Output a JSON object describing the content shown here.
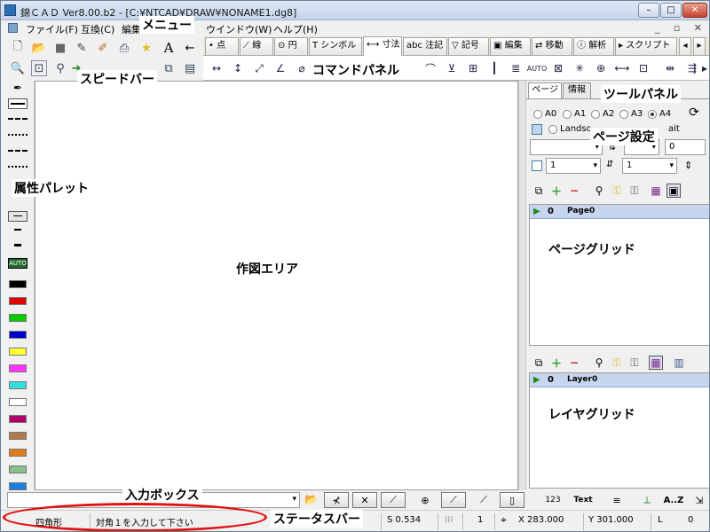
{
  "window": {
    "title": "錦ＣＡＤ Ver8.00.b2 - [C:¥NTCAD¥DRAW¥NONAME1.dg8]",
    "controls": {
      "minimize": "–",
      "maximize": "□",
      "close": "✕"
    }
  },
  "menu": {
    "items": [
      "ファイル(F)",
      "互換(C)",
      "編集",
      "ウインドウ(W)",
      "ヘルプ(H)"
    ]
  },
  "command_tabs": [
    "点",
    "線",
    "円",
    "シンボル",
    "寸法",
    "注記",
    "記号",
    "編集",
    "移動",
    "解析",
    "スクリプト"
  ],
  "command_tab_prefixes": [
    "•",
    "⟋",
    "⊙",
    "T",
    "⟷",
    "abc",
    "▽",
    "▣",
    "⇄",
    "ⓘ",
    "▸"
  ],
  "tool_panel": {
    "tabs": [
      "ページ",
      "情報"
    ],
    "paper_sizes": [
      "A0",
      "A1",
      "A2",
      "A3",
      "A4"
    ],
    "selected_paper": "A4",
    "orientation_label": "Landsc",
    "orientation_label_end": "ait",
    "field_zero": "0",
    "combo_a": "1",
    "combo_b": "1",
    "page_grid": {
      "number": "0",
      "name": "Page0"
    },
    "layer_grid": {
      "number": "0",
      "name": "Layer0"
    }
  },
  "status": {
    "mode": "四角形",
    "prompt": "対角１を入力して下さい",
    "scale": "S 0.534",
    "layer_count": "1",
    "x": "X 283.000",
    "y": "Y 301.000",
    "layer": "L",
    "layer_value": "0"
  },
  "input_bar": {
    "text_tool": "Text",
    "sort_tool": "A..Z"
  },
  "annotations": {
    "menu": "メニュー",
    "speedbar": "スピードバー",
    "command_panel": "コマンドパネル",
    "tool_panel": "ツールパネル",
    "page_settings": "ページ設定",
    "attribute_palette": "属性パレット",
    "drawing_area": "作図エリア",
    "page_grid": "ページグリッド",
    "layer_grid": "レイヤグリッド",
    "input_box": "入力ボックス",
    "status_bar": "ステータスバー"
  },
  "colors": {
    "palette": [
      "#000000",
      "#e00000",
      "#00cc00",
      "#0000cc",
      "#ffff33",
      "#ff33ff",
      "#33e0e0",
      "#ffffff",
      "#b0006a",
      "#b07a4a",
      "#e07a1a",
      "#88c088",
      "#1a80e0",
      "#9a70c8"
    ],
    "highlight_ellipse": "#e11111",
    "grid_row": "#c7d6ee"
  },
  "icons": {
    "speedbar_row1": [
      "new-file-icon",
      "open-folder-icon",
      "save-icon",
      "edit-icon",
      "paint-icon",
      "print-icon",
      "favorite-star-icon",
      "text-a-icon",
      "arrow-left-icon"
    ],
    "speedbar_row2": [
      "zoom-icon",
      "zoom-window-icon",
      "zoom-tool-icon",
      "pan-icon",
      "copy-icon",
      "paste-icon"
    ]
  }
}
